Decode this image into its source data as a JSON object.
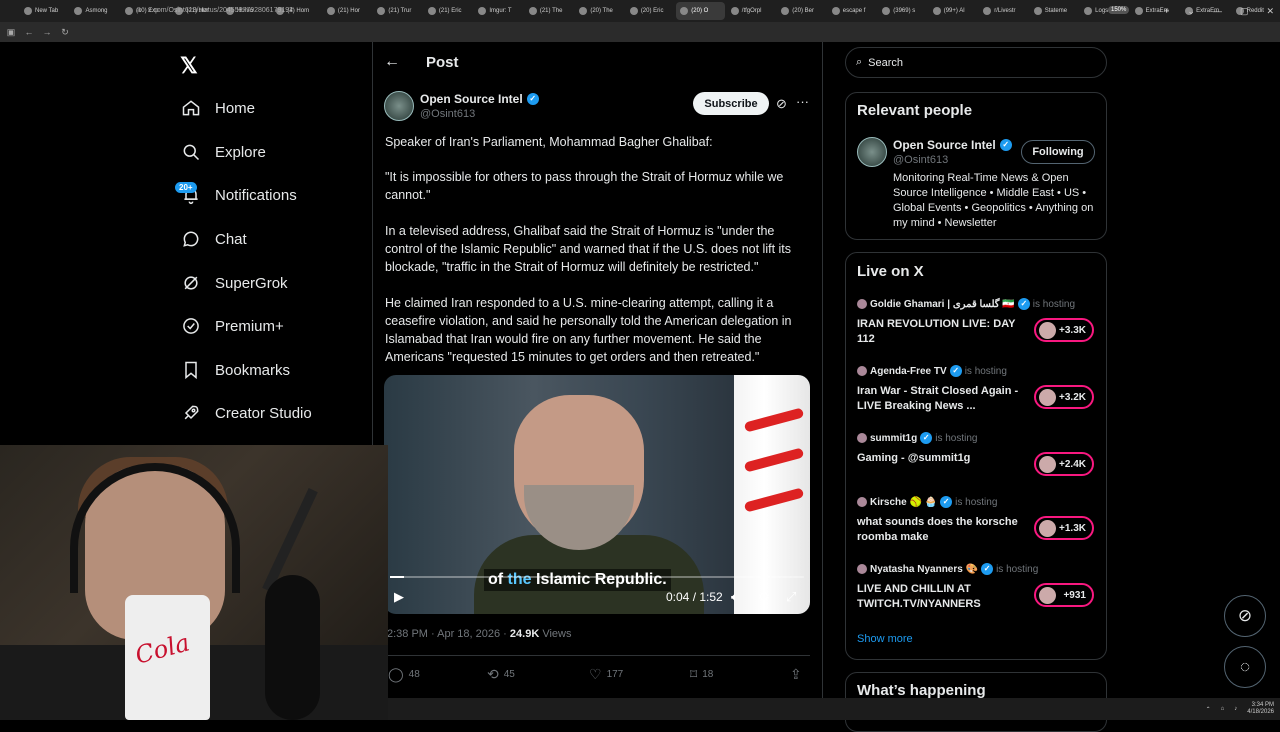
{
  "browser": {
    "tabs": [
      {
        "label": "New Tab",
        "active": false
      },
      {
        "label": "Asmong",
        "active": false
      },
      {
        "label": "(10) Exp",
        "active": false
      },
      {
        "label": "(21) Hor",
        "active": false
      },
      {
        "label": "Homo",
        "active": false
      },
      {
        "label": "(4) Hom",
        "active": false
      },
      {
        "label": "(21) Hor",
        "active": false
      },
      {
        "label": "(21) Trur",
        "active": false
      },
      {
        "label": "(21) Eric",
        "active": false
      },
      {
        "label": "Imgur: T",
        "active": false
      },
      {
        "label": "(21) The",
        "active": false
      },
      {
        "label": "(20) The",
        "active": false
      },
      {
        "label": "(20) Eric",
        "active": false
      },
      {
        "label": "(20) O",
        "active": true
      },
      {
        "label": "/tfgOrpl",
        "active": false
      },
      {
        "label": "(20) Ber",
        "active": false
      },
      {
        "label": "escape f",
        "active": false
      },
      {
        "label": "(3969) s",
        "active": false
      },
      {
        "label": "(99+) Al",
        "active": false
      },
      {
        "label": "r/Livestr",
        "active": false
      },
      {
        "label": "Stateme",
        "active": false
      },
      {
        "label": "Logs —",
        "active": false
      },
      {
        "label": "ExtraEm",
        "active": false
      },
      {
        "label": "ExtraEm",
        "active": false
      },
      {
        "label": "Reddit",
        "active": false
      }
    ],
    "url": "x.com/Osint613/status/2045587792806179192",
    "zoom": "150%"
  },
  "sidebar": {
    "items": [
      {
        "label": "Home",
        "icon": "home-icon"
      },
      {
        "label": "Explore",
        "icon": "search-icon"
      },
      {
        "label": "Notifications",
        "icon": "bell-icon"
      },
      {
        "label": "Chat",
        "icon": "chat-icon"
      },
      {
        "label": "SuperGrok",
        "icon": "grok-icon"
      },
      {
        "label": "Premium+",
        "icon": "premium-icon"
      },
      {
        "label": "Bookmarks",
        "icon": "bookmark-icon"
      },
      {
        "label": "Creator Studio",
        "icon": "rocket-icon"
      }
    ],
    "notification_badge": "20+"
  },
  "post": {
    "header_title": "Post",
    "author_name": "Open Source Intel",
    "author_handle": "@Osint613",
    "subscribe_label": "Subscribe",
    "paragraphs": [
      "Speaker of Iran's Parliament, Mohammad Bagher Ghalibaf:",
      "\"It is impossible for others to pass through the Strait of Hormuz while we cannot.\"",
      "In a televised address, Ghalibaf said the Strait of Hormuz is \"under the control of the Islamic Republic\" and warned that if the U.S. does not lift its blockade, \"traffic in the Strait of Hormuz will definitely be restricted.\"",
      "He claimed Iran responded to a U.S. mine-clearing attempt, calling it a ceasefire violation, and said he personally told the American delegation in Islamabad that Iran would fire on any further movement. He said the Americans \"requested 15 minutes to get orders and then retreated.\""
    ],
    "video": {
      "subtitle_pre": "of ",
      "subtitle_hl": "the",
      "subtitle_post": " Islamic Republic.",
      "time": "0:04 / 1:52",
      "progress_fraction": 0.035
    },
    "meta_time": "2:38 PM · Apr 18, 2026 · ",
    "views_count": "24.9K",
    "views_label": " Views",
    "actions": {
      "replies": "48",
      "reposts": "45",
      "likes": "177",
      "bookmarks": "18"
    }
  },
  "right": {
    "search_placeholder": "Search",
    "relevant_people_title": "Relevant people",
    "relevant_person": {
      "name": "Open Source Intel",
      "handle": "@Osint613",
      "follow_label": "Following",
      "bio": "Monitoring Real-Time News & Open Source Intelligence • Middle East • US • Global Events • Geopolitics • Anything on my mind • Newsletter"
    },
    "live_title": "Live on X",
    "live_items": [
      {
        "host": "Goldie Ghamari | گلسا قمری 🇮🇷",
        "status": "is hosting",
        "title": "IRAN REVOLUTION LIVE: DAY 112",
        "count": "+3.3K"
      },
      {
        "host": "Agenda-Free TV",
        "status": "is hosting",
        "title": "Iran War - Strait Closed Again - LIVE Breaking News ...",
        "count": "+3.2K"
      },
      {
        "host": "summit1g",
        "status": "is hosting",
        "title": "Gaming - @summit1g",
        "count": "+2.4K"
      },
      {
        "host": "Kirsche 🥎 🧁",
        "status": "is hosting",
        "title": "what sounds does the korsche roomba make",
        "count": "+1.3K"
      },
      {
        "host": "Nyatasha Nyanners 🎨",
        "status": "is hosting",
        "title": "LIVE AND CHILLIN AT TWITCH.TV/NYANNERS",
        "count": "+931"
      }
    ],
    "show_more": "Show more",
    "whats_happening": "What’s happening"
  },
  "taskbar": {
    "time": "3:34 PM",
    "date": "4/18/2026"
  },
  "colors": {
    "accent": "#1d9bf0",
    "live": "#f91880",
    "background": "#000000"
  }
}
